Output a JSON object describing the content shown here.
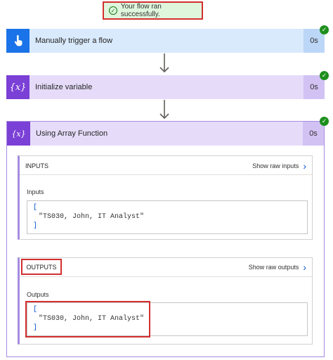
{
  "banner": {
    "message": "Your flow ran successfully."
  },
  "steps": [
    {
      "title": "Manually trigger a flow",
      "duration": "0s",
      "color": "#1a73e8"
    },
    {
      "title": "Initialize variable",
      "duration": "0s",
      "color": "#7b40d6"
    },
    {
      "title": "Using Array Function",
      "duration": "0s",
      "color": "#7b40d6"
    }
  ],
  "inputs": {
    "header": "INPUTS",
    "raw_label": "Show raw inputs",
    "field_label": "Inputs",
    "open_bracket": "[",
    "value": "\"TS030, John, IT Analyst\"",
    "close_bracket": "]"
  },
  "outputs": {
    "header": "OUTPUTS",
    "raw_label": "Show raw outputs",
    "field_label": "Outputs",
    "open_bracket": "[",
    "value": "\"TS030, John, IT Analyst\"",
    "close_bracket": "]"
  },
  "colors": {
    "success": "#1c8f1c",
    "highlight": "#d32f2f"
  }
}
